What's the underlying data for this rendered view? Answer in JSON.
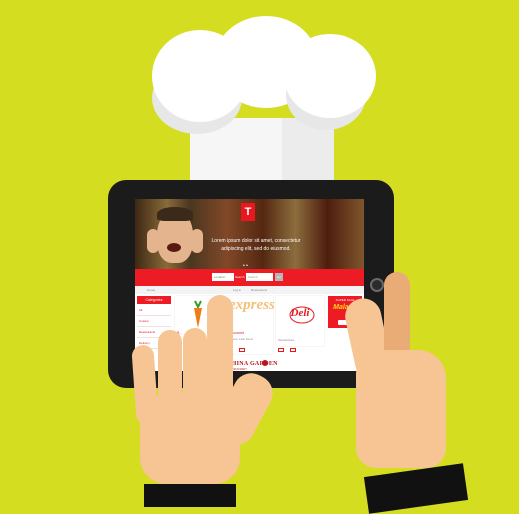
{
  "colors": {
    "background": "#d4dd1f",
    "brand_red": "#ed1c24",
    "tablet": "#1b1b1b",
    "skin": "#f7c493",
    "hat": "#ffffff"
  },
  "site": {
    "logo_letter": "T",
    "hero_text": "Lorem ipsum dolor sit amet, consectetur adipiscing elit, sed do eiusmod.",
    "hero_dots": "• •",
    "search": {
      "location_placeholder": "Location",
      "divider": "Search",
      "query_placeholder": "Search",
      "go_label": "Go"
    },
    "sub_links": [
      "Home",
      "Log in",
      "Restaurants"
    ],
    "categories": {
      "title": "Categories",
      "items": [
        "All",
        "Cuisine",
        "Restaurants",
        "Delivery"
      ]
    },
    "cards": [
      {
        "title": "B...",
        "subtitle": ""
      },
      {
        "brand": "express",
        "title": "El gourmet",
        "subtitle": "Burgers, Fast Food"
      },
      {
        "brand": "Deli",
        "title": "",
        "subtitle": "Sandwiches"
      },
      {
        "top": "SUPER SALE",
        "brand": "Malaga",
        "title": "",
        "subtitle": ""
      }
    ],
    "china_garden": {
      "name": "CHINA GARDEN",
      "tagline": "RESTAURANT"
    }
  }
}
